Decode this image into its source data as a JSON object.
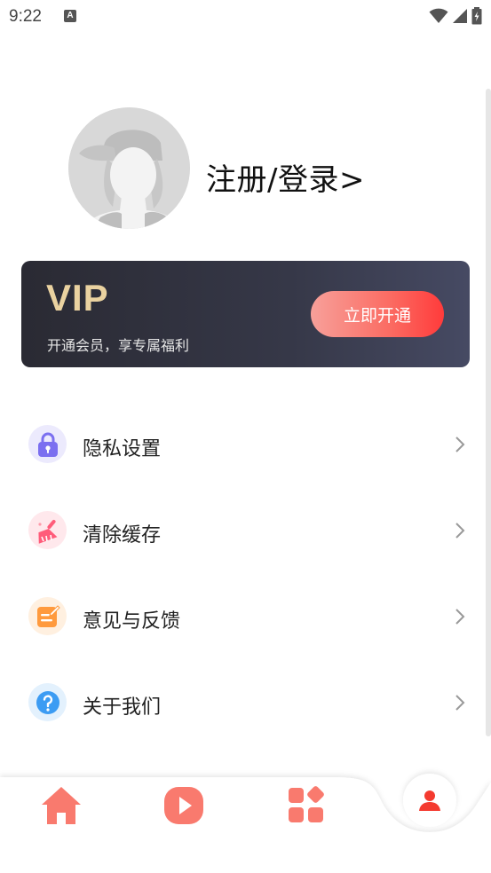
{
  "status_bar": {
    "time": "9:22",
    "notification_icon": "A",
    "icons": [
      "wifi-icon",
      "signal-icon",
      "battery-icon"
    ]
  },
  "profile": {
    "login_label": "注册/登录>"
  },
  "vip": {
    "title": "VIP",
    "subtitle": "开通会员，享专属福利",
    "button_label": "立即开通",
    "title_color": "#ead2a0",
    "button_color": "#fb6b62"
  },
  "menu": {
    "items": [
      {
        "label": "隐私设置",
        "icon": "lock-icon",
        "icon_color": "#7b6ff0"
      },
      {
        "label": "清除缓存",
        "icon": "broom-icon",
        "icon_color": "#ff5c7a"
      },
      {
        "label": "意见与反馈",
        "icon": "feedback-icon",
        "icon_color": "#ff9a3d"
      },
      {
        "label": "关于我们",
        "icon": "question-icon",
        "icon_color": "#3c9cf3"
      }
    ]
  },
  "bottom_nav": {
    "items": [
      {
        "icon": "home-icon"
      },
      {
        "icon": "play-icon"
      },
      {
        "icon": "apps-icon"
      },
      {
        "icon": "profile-icon",
        "active": true
      }
    ],
    "accent_color": "#f97a6e",
    "active_color": "#f43a2f"
  }
}
